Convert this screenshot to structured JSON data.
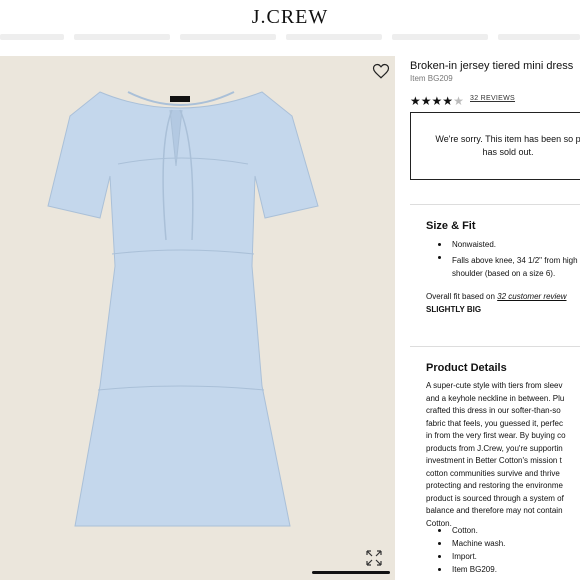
{
  "header": {
    "logo": "J.CREW"
  },
  "product": {
    "title": "Broken-in jersey tiered mini dress",
    "item_number": "Item BG209",
    "rating_stars": 4,
    "reviews_link": "32 REVIEWS"
  },
  "availability": {
    "message_lines": [
      "We're sorry. This item has been so p",
      "has sold out."
    ]
  },
  "size_fit": {
    "heading": "Size & Fit",
    "bullets": [
      "Nonwaisted.",
      "Falls above knee, 34 1/2\" from high",
      "shoulder (based on a size 6)."
    ],
    "overall_fit_prefix": "Overall fit based on ",
    "overall_fit_link": "32 customer review",
    "overall_fit_result": "SLIGHTLY BIG"
  },
  "product_details": {
    "heading": "Product Details",
    "description_lines": [
      "A super-cute style with tiers from sleev",
      "and a keyhole neckline in between. Plu",
      "crafted this dress in our softer-than-so",
      "fabric that feels, you guessed it, perfec",
      "in from the very first wear. By buying co",
      "products from J.Crew, you're supportin",
      "investment in Better Cotton's mission t",
      "cotton communities survive and thrive",
      "protecting and restoring the environme",
      "product is sourced through a system of",
      "balance and therefore may not contain",
      "Cotton."
    ],
    "bullets": [
      "Cotton.",
      "Machine wash.",
      "Import.",
      "Item BG209."
    ]
  },
  "colors": {
    "gallery_bg": "#ebe6dc",
    "dress": "#c4d7ec"
  },
  "icons": {
    "favorite": "heart-icon",
    "zoom": "expand-icon"
  }
}
